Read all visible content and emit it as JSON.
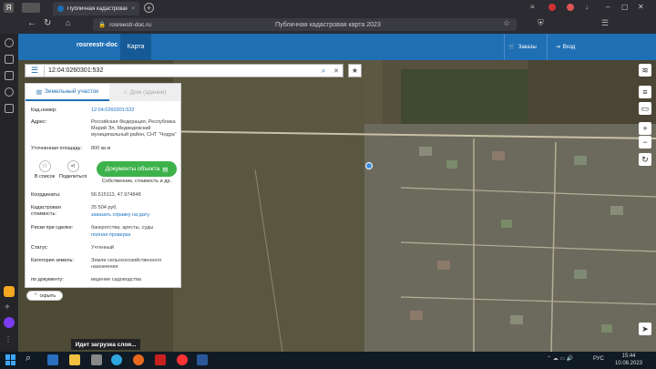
{
  "browser": {
    "tab_title": "Публичная кадастровая",
    "url": "rosreestr-doc.ru",
    "page_title": "Публичная кадастровая карта 2023"
  },
  "header": {
    "logo": "rosreestr-doc",
    "map_label": "Карта",
    "orders_label": "Заказы",
    "login_label": "Вход"
  },
  "search": {
    "value": "12:04:0260301:532"
  },
  "panel": {
    "tab_active": "Земельный участок",
    "tab_inactive": "Дом (здание)",
    "cad_label": "Кад.номер:",
    "cad_value": "12:04:0260301:532",
    "address_label": "Адрес:",
    "address_value": "Российская Федерация, Республика Марий Эл, Медведевский муниципальный район, СНТ \"Чодра\"",
    "area_label": "Уточненная площадь:",
    "area_value": "800 кв.м",
    "to_list": "В список",
    "share": "Поделиться",
    "docs_button": "Документы объекта",
    "docs_sub": "Собственник, стоимость и др.",
    "coords_label": "Координаты:",
    "coords_value": "56.515113, 47.974848",
    "cost_label": "Кадастровая стоимость:",
    "cost_value": "25 504 руб.",
    "cost_link": "заказать справку на дату",
    "risk_label": "Риски при сделке:",
    "risk_value": "банкротства, аресты, суды",
    "risk_link": "полная проверка",
    "status_label": "Статус:",
    "status_value": "Учтенный",
    "category_label": "Категория земель:",
    "category_value": "Земли сельскохозяйственного назначения",
    "usage_label": "по документу:",
    "usage_value": "ведение садоводства",
    "hide": "скрыть"
  },
  "taskbar": {
    "search_text": "Идет загрузка слоя...",
    "lang": "РУС",
    "time": "15:44",
    "date": "10.08.2023"
  }
}
